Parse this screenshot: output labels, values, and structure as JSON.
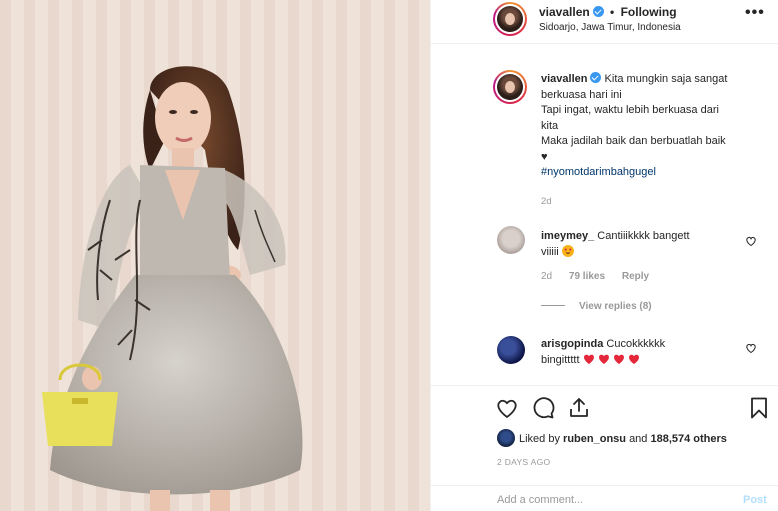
{
  "header": {
    "username": "viavallen",
    "separator": "•",
    "follow_status": "Following",
    "location": "Sidoarjo, Jawa Timur, Indonesia",
    "more_icon": "ellipsis-icon"
  },
  "caption": {
    "username": "viavallen",
    "lines": [
      "Kita mungkin saja sangat",
      "berkuasa hari ini",
      "Tapi ingat, waktu lebih berkuasa dari",
      "kita",
      "Maka jadilah baik dan berbuatlah baik",
      "♥"
    ],
    "hashtag": "#nyomotdarimbahgugel",
    "time": "2d"
  },
  "comments": [
    {
      "username": "imeymey_",
      "text": "Cantiiikkkk bangett",
      "text2": "viiiii",
      "time": "2d",
      "likes": "79 likes",
      "reply": "Reply",
      "view_replies": "View replies (8)"
    },
    {
      "username": "arisgopinda",
      "text": "Cucokkkkkk",
      "text2": "bingittttt"
    }
  ],
  "actions": {
    "liked_by_prefix": "Liked by",
    "liked_by_user": "ruben_onsu",
    "liked_by_and": "and",
    "liked_by_count": "188,574 others",
    "posted_ago": "2 DAYS AGO"
  },
  "add_comment": {
    "placeholder": "Add a comment...",
    "post_label": "Post"
  },
  "colors": {
    "link": "#003569",
    "verified": "#3897f0",
    "post_button": "#b2dffc",
    "muted": "#999999"
  }
}
